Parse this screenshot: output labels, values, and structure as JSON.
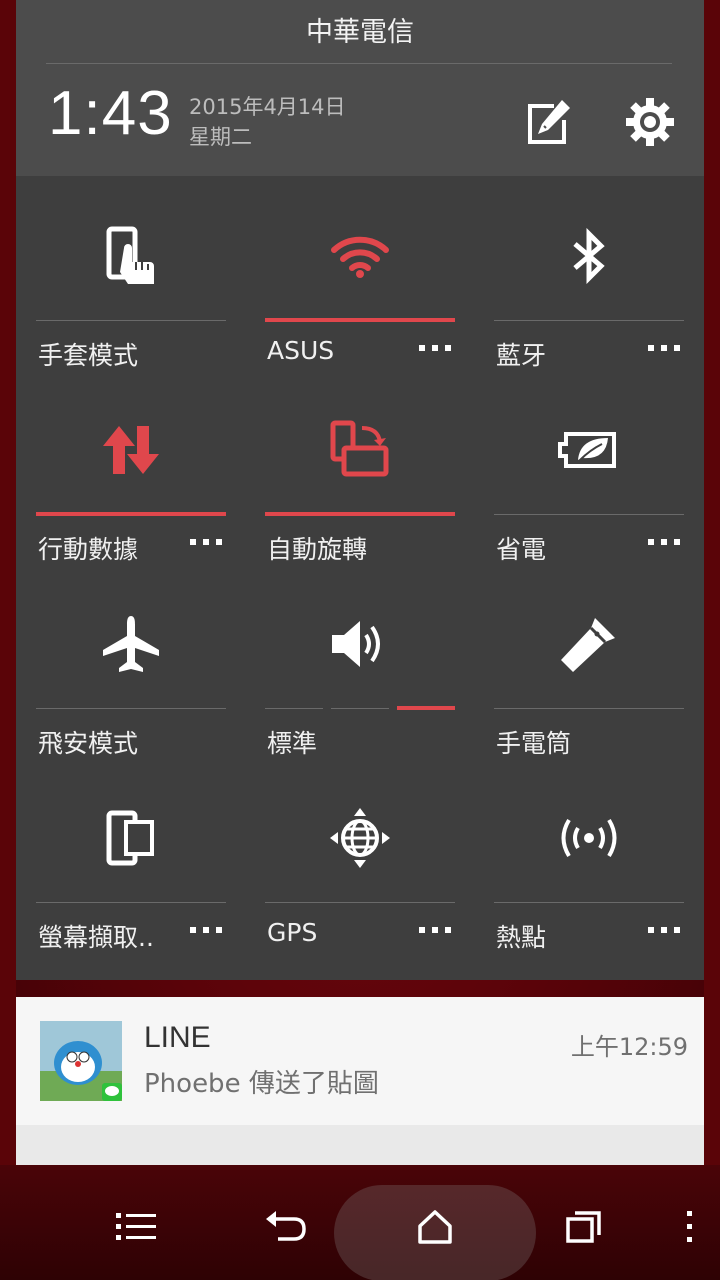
{
  "status": {
    "carrier": "中華電信"
  },
  "header": {
    "time": "1:43",
    "date": "2015年4月14日",
    "weekday": "星期二",
    "edit_icon": "edit-icon",
    "settings_icon": "gear-icon"
  },
  "tiles": [
    {
      "label": "手套模式",
      "icon": "glove-mode-icon",
      "active": false,
      "more": false
    },
    {
      "label": "ASUS",
      "icon": "wifi-icon",
      "active": true,
      "more": true
    },
    {
      "label": "藍牙",
      "icon": "bluetooth-icon",
      "active": false,
      "more": true
    },
    {
      "label": "行動數據",
      "icon": "mobile-data-icon",
      "active": true,
      "more": true
    },
    {
      "label": "自動旋轉",
      "icon": "auto-rotate-icon",
      "active": true,
      "more": false
    },
    {
      "label": "省電",
      "icon": "battery-saver-icon",
      "active": false,
      "more": true
    },
    {
      "label": "飛安模式",
      "icon": "airplane-icon",
      "active": false,
      "more": false
    },
    {
      "label": "標準",
      "icon": "volume-icon",
      "active": false,
      "more": false
    },
    {
      "label": "手電筒",
      "icon": "flashlight-icon",
      "active": false,
      "more": false
    },
    {
      "label": "螢幕擷取..",
      "icon": "screenshot-icon",
      "active": false,
      "more": true
    },
    {
      "label": "GPS",
      "icon": "gps-icon",
      "active": false,
      "more": true
    },
    {
      "label": "熱點",
      "icon": "hotspot-icon",
      "active": false,
      "more": true
    }
  ],
  "notification": {
    "app": "LINE",
    "message": "Phoebe 傳送了貼圖",
    "time": "上午12:59"
  },
  "navbar": {
    "menu_icon": "menu-icon",
    "back_icon": "back-icon",
    "home_icon": "home-icon",
    "recents_icon": "recents-icon",
    "overflow_icon": "overflow-icon"
  },
  "colors": {
    "accent": "#e0474c",
    "panel": "#3e3e3e",
    "header": "#4c4c4c"
  }
}
